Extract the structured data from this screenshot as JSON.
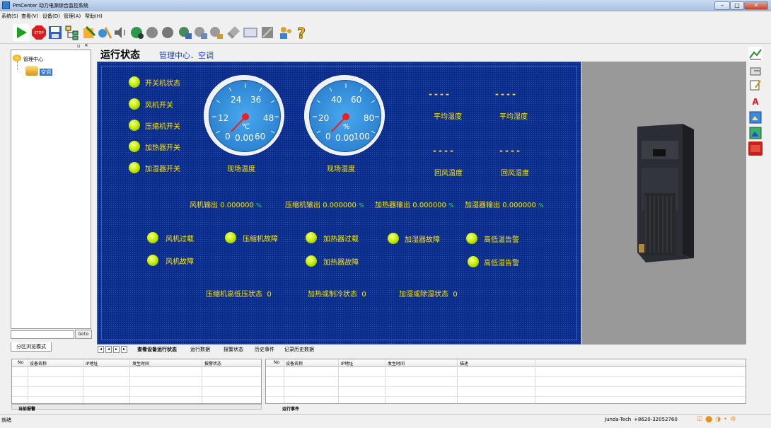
{
  "window": {
    "title": "PmCenter 动力电源综合监控系统"
  },
  "menu": [
    "系统(S)",
    "查看(V)",
    "设备(D)",
    "管理(A)",
    "帮助(H)"
  ],
  "sidebar": {
    "tree_root": "管理中心",
    "tree_child": "空调",
    "goto_label": "Goto",
    "tab_label": "分区浏览模式"
  },
  "page": {
    "title": "运行状态",
    "subtitle": "管理中心．空调"
  },
  "status_items": [
    "开关机状态",
    "风机开关",
    "压缩机开关",
    "加热器开关",
    "加湿器开关"
  ],
  "gauges": [
    {
      "name": "现场温度",
      "unit": "℃",
      "value": "0.00",
      "ticks": [
        "12",
        "24",
        "36",
        "48",
        "0",
        "60"
      ]
    },
    {
      "name": "现场湿度",
      "unit": "%",
      "value": "0.00",
      "ticks": [
        "20",
        "40",
        "60",
        "80",
        "0",
        "100"
      ]
    }
  ],
  "readouts": [
    {
      "value": "----",
      "label": "平均温度"
    },
    {
      "value": "----",
      "label": "平均湿度"
    },
    {
      "value": "----",
      "label": "回风温度"
    },
    {
      "value": "----",
      "label": "回风湿度"
    }
  ],
  "outputs": [
    {
      "label": "风机输出",
      "value": "0.000000",
      "unit": "%"
    },
    {
      "label": "压缩机输出",
      "value": "0.000000",
      "unit": "%"
    },
    {
      "label": "加热器输出",
      "value": "0.000000",
      "unit": "%"
    },
    {
      "label": "加湿器输出",
      "value": "0.000000",
      "unit": "%"
    }
  ],
  "alarms": [
    "风机过载",
    "压缩机故障",
    "加热器过载",
    "加湿器故障",
    "高低温告警",
    "风机故障",
    "加热器故障",
    "高低湿告警"
  ],
  "states": [
    {
      "label": "压缩机高低压状态",
      "value": "0"
    },
    {
      "label": "加热或制冷状态",
      "value": "0"
    },
    {
      "label": "加湿或除湿状态",
      "value": "0"
    }
  ],
  "tabs": [
    "查看设备运行状态",
    "运行数据",
    "报警状态",
    "历史事件",
    "记录历史数据"
  ],
  "alarm_grid": {
    "columns": [
      "No",
      "设备名称",
      "IP地址",
      "发生时间",
      "报警状态"
    ],
    "tab": "当前报警"
  },
  "event_grid": {
    "columns": [
      "No",
      "设备名称",
      "IP地址",
      "发生时间",
      "描述"
    ],
    "tab": "运行事件"
  },
  "statusbar": {
    "left": "就绪",
    "company": "Junda-Tech",
    "phone": "+8620-32052760"
  },
  "colors": {
    "panel_bg": "#0a2d8c",
    "label": "#ffe600",
    "unit": "#39e039",
    "led": "#c8f000"
  }
}
